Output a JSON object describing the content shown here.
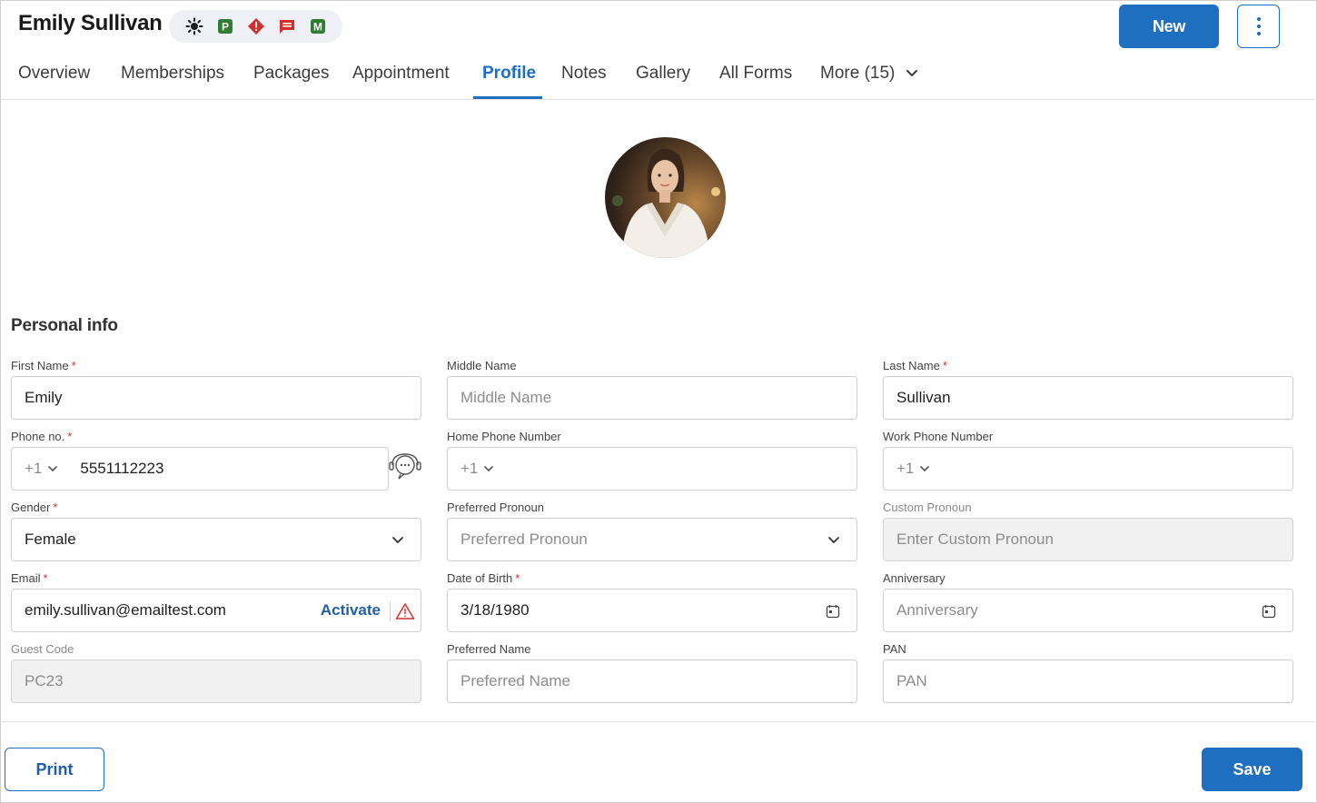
{
  "header": {
    "title": "Emily Sullivan",
    "badges": [
      {
        "icon": "sun-icon",
        "color": "#1a1a1a"
      },
      {
        "icon": "p-badge-icon",
        "letter": "P",
        "color": "#2e7d32"
      },
      {
        "icon": "alert-icon",
        "color": "#d32f2f"
      },
      {
        "icon": "message-icon",
        "color": "#d32f2f"
      },
      {
        "icon": "m-badge-icon",
        "letter": "M",
        "color": "#2e7d32"
      }
    ],
    "new_label": "New",
    "more_actions_icon": "kebab-icon"
  },
  "tabs": [
    {
      "label": "Overview",
      "active": false
    },
    {
      "label": "Memberships",
      "active": false
    },
    {
      "label": "Packages",
      "active": false
    },
    {
      "label": "Appointment",
      "active": false
    },
    {
      "label": "Profile",
      "active": true
    },
    {
      "label": "Notes",
      "active": false
    },
    {
      "label": "Gallery",
      "active": false
    },
    {
      "label": "All Forms",
      "active": false
    },
    {
      "label": "More (15)",
      "active": false
    }
  ],
  "profile": {
    "section_title": "Personal info",
    "first_name": {
      "label": "First Name",
      "value": "Emily",
      "required": "*"
    },
    "middle_name": {
      "label": "Middle Name",
      "placeholder": "Middle Name"
    },
    "last_name": {
      "label": "Last Name",
      "value": "Sullivan",
      "required": "*"
    },
    "phone": {
      "label": "Phone no.",
      "required": "*",
      "country_code": "+1",
      "value": "5551112223"
    },
    "home_phone": {
      "label": "Home Phone Number",
      "country_code": "+1"
    },
    "work_phone": {
      "label": "Work Phone Number",
      "country_code": "+1"
    },
    "gender": {
      "label": "Gender",
      "required": "*",
      "value": "Female"
    },
    "preferred_pronoun": {
      "label": "Preferred Pronoun",
      "placeholder": "Preferred Pronoun"
    },
    "custom_pronoun": {
      "label": "Custom Pronoun",
      "placeholder": "Enter Custom Pronoun"
    },
    "email": {
      "label": "Email",
      "required": "*",
      "value": "emily.sullivan@emailtest.com",
      "action": "Activate"
    },
    "dob": {
      "label": "Date of Birth",
      "required": "*",
      "value": "3/18/1980"
    },
    "anniversary": {
      "label": "Anniversary",
      "placeholder": "Anniversary"
    },
    "guest_code": {
      "label": "Guest Code",
      "value": "PC23"
    },
    "preferred_name": {
      "label": "Preferred Name",
      "placeholder": "Preferred Name"
    },
    "pan": {
      "label": "PAN",
      "placeholder": "PAN"
    }
  },
  "footer": {
    "print_label": "Print",
    "save_label": "Save"
  },
  "colors": {
    "accent": "#1f6fc0",
    "required": "#d32f2f",
    "warning": "#d32f2f"
  }
}
